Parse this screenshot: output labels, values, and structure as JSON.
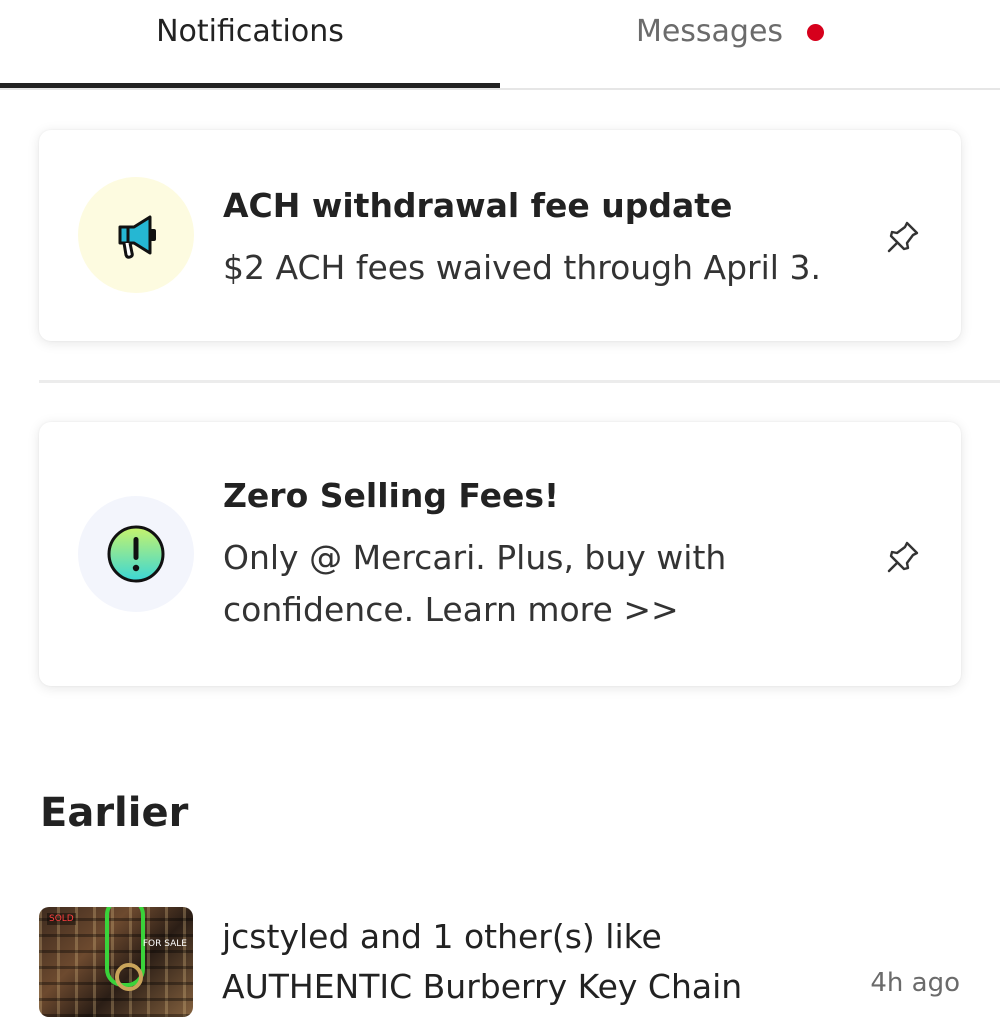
{
  "tabs": {
    "notifications": "Notifications",
    "messages": "Messages",
    "messages_unread_color": "#d6001c"
  },
  "cards": [
    {
      "title": "ACH withdrawal fee update",
      "body": "$2 ACH fees waived through April 3.",
      "icon": "megaphone-icon",
      "icon_bg": "#fdfbe0",
      "pinned_icon": "pin-icon"
    },
    {
      "title": "Zero Selling Fees!",
      "body_line1": "Only @ Mercari. Plus, buy with",
      "body_line2": "confidence. Learn more >>",
      "icon": "exclamation-icon",
      "icon_bg": "#f3f5fc",
      "pinned_icon": "pin-icon"
    }
  ],
  "earlier": {
    "title": "Earlier",
    "items": [
      {
        "text_line1": "jcstyled and 1 other(s) like",
        "text_line2": "AUTHENTIC Burberry Key Chain",
        "time": "4h ago",
        "thumb_sold": "SOLD",
        "thumb_forsale": "FOR SALE"
      }
    ]
  }
}
